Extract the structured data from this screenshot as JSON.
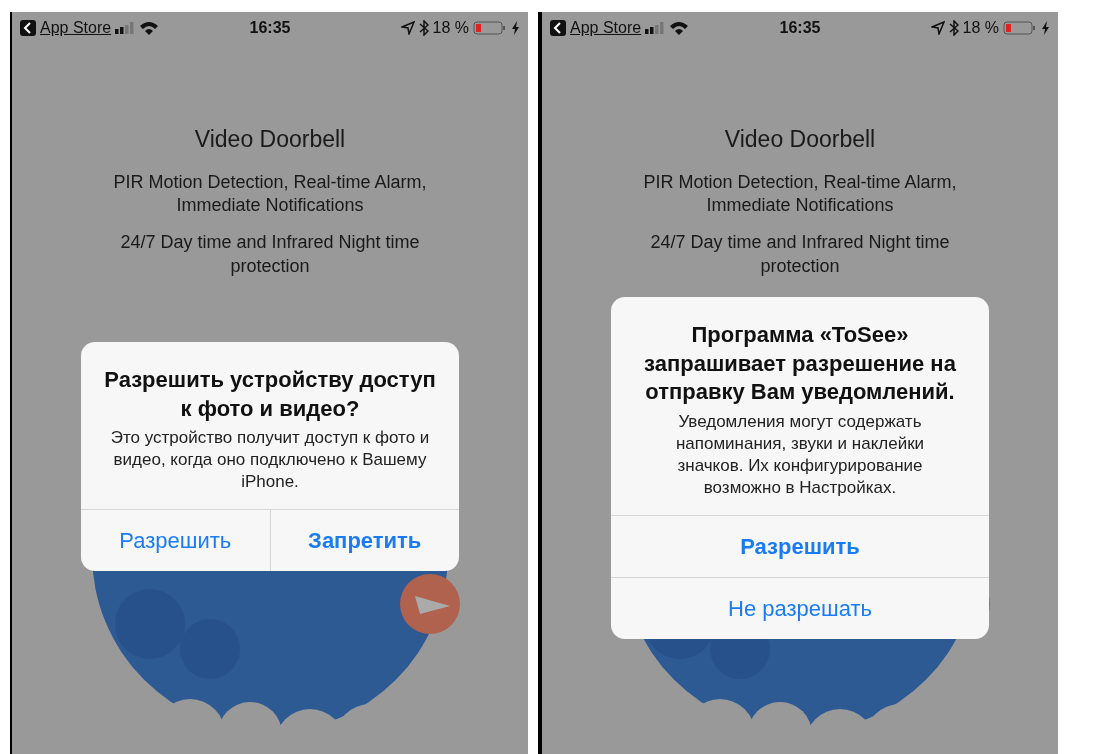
{
  "screens": [
    {
      "status_bar": {
        "back_label": "App Store",
        "time": "16:35",
        "battery_text": "18 %"
      },
      "title": "Video Doorbell",
      "features": [
        "PIR Motion Detection, Real-time Alarm, Immediate Notifications",
        "24/7 Day time and Infrared Night time protection"
      ],
      "alert": {
        "kind": "side-by-side",
        "title": "Разрешить устройству доступ к фото и видео?",
        "message": "Это устройство получит доступ к фото и видео, когда оно подключено к Вашему iPhone.",
        "buttons": [
          {
            "label": "Разрешить",
            "bold": false
          },
          {
            "label": "Запретить",
            "bold": true
          }
        ]
      }
    },
    {
      "status_bar": {
        "back_label": "App Store",
        "time": "16:35",
        "battery_text": "18 %"
      },
      "title": "Video Doorbell",
      "features": [
        "PIR Motion Detection, Real-time Alarm, Immediate Notifications",
        "24/7 Day time and Infrared Night time protection"
      ],
      "alert": {
        "kind": "stacked",
        "title": "Программа «ToSee» запрашивает разрешение на отправку Вам уведомлений.",
        "message": "Уведомления могут содержать напоминания, звуки и наклейки значков. Их конфигурирование возможно в Настройках.",
        "buttons": [
          {
            "label": "Разрешить",
            "bold": true
          },
          {
            "label": "Не разрешать",
            "bold": false
          }
        ]
      }
    }
  ]
}
